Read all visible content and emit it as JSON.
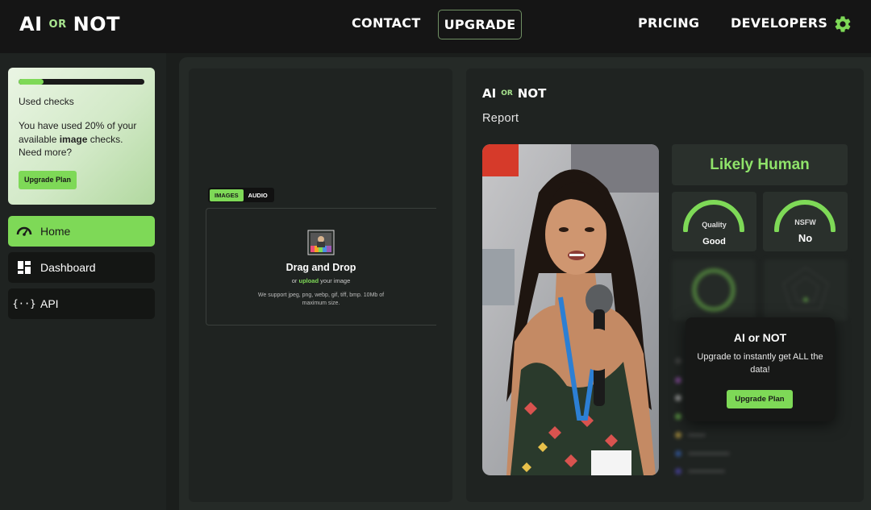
{
  "brand": {
    "left": "AI",
    "middle": "OR",
    "right": "NOT"
  },
  "nav": {
    "contact": "CONTACT",
    "upgrade": "UPGRADE",
    "pricing": "PRICING",
    "developers": "DEVELOPERS",
    "settings_icon": "gear-icon"
  },
  "usage": {
    "progress_percent": 20,
    "label": "Used checks",
    "text_before": "You have used 20% of your available ",
    "text_bold": "image",
    "text_after": " checks. Need more?",
    "button": "Upgrade Plan"
  },
  "sidebar": {
    "items": [
      {
        "label": "Home",
        "icon": "speedometer-icon",
        "active": true
      },
      {
        "label": "Dashboard",
        "icon": "dashboard-icon",
        "active": false
      },
      {
        "label": "API",
        "icon": "code-braces-icon",
        "active": false
      }
    ]
  },
  "upload": {
    "tabs": [
      "IMAGES",
      "AUDIO"
    ],
    "active_tab": "IMAGES",
    "title": "Drag and Drop",
    "sub_before": "or ",
    "sub_link": "upload",
    "sub_after": " your image",
    "note": "We support jpeg, png, webp, gif, tiff, bmp. 10Mb of maximum size."
  },
  "report": {
    "title": "Report",
    "verdict": "Likely Human",
    "quality_label": "Quality",
    "quality_value": "Good",
    "nsfw_label": "NSFW",
    "nsfw_value": "No"
  },
  "modal": {
    "title": "AI or NOT",
    "text": "Upgrade to instantly get ALL the data!",
    "button": "Upgrade Plan"
  },
  "colors": {
    "accent": "#7ed957",
    "verdict": "#8fe36a",
    "panel": "#1f2321",
    "background": "#1b1e1c"
  }
}
